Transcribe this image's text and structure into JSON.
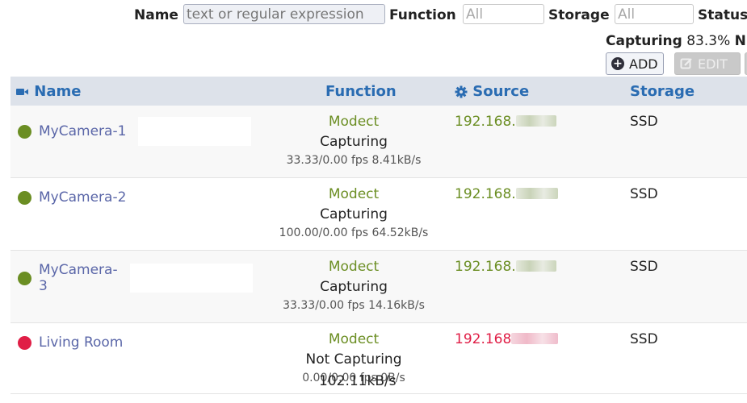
{
  "filters": {
    "name_label": "Name",
    "name_placeholder": "text or regular expression",
    "function_label": "Function",
    "function_value": "All",
    "storage_label": "Storage",
    "storage_value": "All",
    "status_label": "Status"
  },
  "summary": {
    "capturing_label": "Capturing",
    "capturing_value": "83.3%",
    "cut_char": "N"
  },
  "toolbar": {
    "add_label": "ADD",
    "edit_label": "EDIT"
  },
  "table": {
    "headers": {
      "name": "Name",
      "function": "Function",
      "source": "Source",
      "storage": "Storage"
    },
    "rows": [
      {
        "name": "MyCamera-1",
        "status_color": "#6b8e23",
        "function": "Modect",
        "state": "Capturing",
        "rate": "33.33/0.00 fps 8.41kB/s",
        "source": "192.168.",
        "storage": "SSD"
      },
      {
        "name": "MyCamera-2",
        "status_color": "#6b8e23",
        "function": "Modect",
        "state": "Capturing",
        "rate": "100.00/0.00 fps 64.52kB/s",
        "source": "192.168.",
        "storage": "SSD"
      },
      {
        "name": "MyCamera-3",
        "status_color": "#6b8e23",
        "function": "Modect",
        "state": "Capturing",
        "rate": "33.33/0.00 fps 14.16kB/s",
        "source": "192.168.",
        "storage": "SSD"
      },
      {
        "name": "Living Room",
        "status_color": "#e01e46",
        "function": "Modect",
        "state": "Not Capturing",
        "rate": "0.00/0.00 fps 0B/s",
        "source": "192.168",
        "storage": "SSD"
      }
    ]
  },
  "footer": {
    "total_rate": "102.11kB/s"
  },
  "icons": {
    "name_header": "video-camera-icon",
    "source_header": "gear-icon",
    "add": "plus-circle-icon",
    "edit": "edit-icon"
  }
}
